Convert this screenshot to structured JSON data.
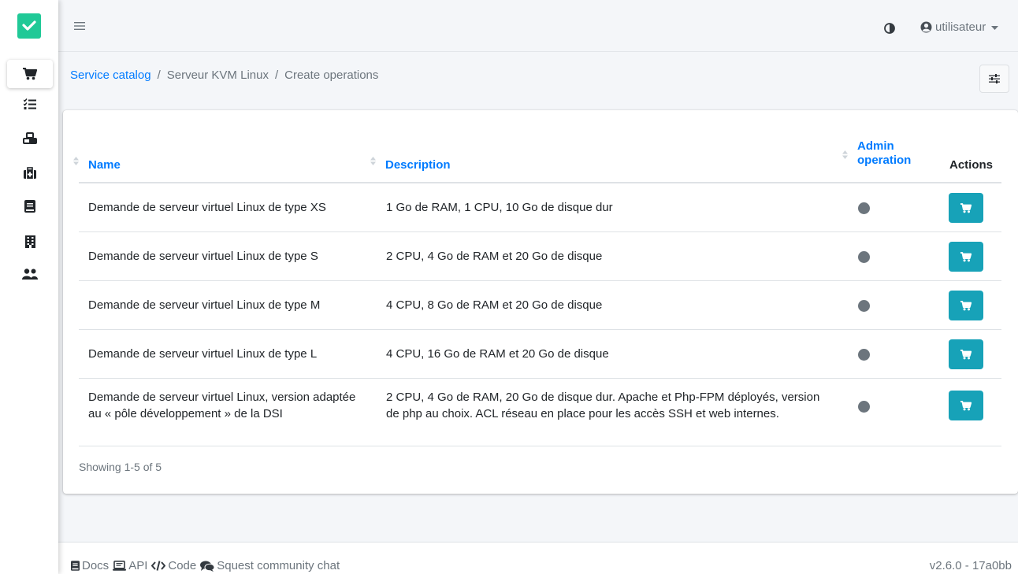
{
  "app": {
    "brand_color": "#20c997",
    "accent_color": "#17a2b8",
    "link_color": "#007bff"
  },
  "sidebar": {
    "items": [
      {
        "icon": "cart-icon",
        "active": true
      },
      {
        "icon": "tasks-icon",
        "active": false
      },
      {
        "icon": "cubes-icon",
        "active": false
      },
      {
        "icon": "medkit-icon",
        "active": false
      },
      {
        "icon": "book-icon",
        "active": false
      },
      {
        "icon": "building-icon",
        "active": false
      },
      {
        "icon": "users-icon",
        "active": false
      }
    ]
  },
  "header": {
    "user_name": "utilisateur"
  },
  "breadcrumb": {
    "items": [
      "Service catalog",
      "Serveur KVM Linux",
      "Create operations"
    ]
  },
  "table": {
    "columns": {
      "name": "Name",
      "description": "Description",
      "admin_line1": "Admin",
      "admin_line2": "operation",
      "actions": "Actions"
    },
    "rows": [
      {
        "name": "Demande de serveur virtuel Linux de type XS",
        "description": "1 Go de RAM, 1 CPU, 10 Go de disque dur"
      },
      {
        "name": "Demande de serveur virtuel Linux de type S",
        "description": "2 CPU, 4 Go de RAM et 20 Go de disque"
      },
      {
        "name": "Demande de serveur virtuel Linux de type M",
        "description": "4 CPU, 8 Go de RAM et 20 Go de disque"
      },
      {
        "name": "Demande de serveur virtuel Linux de type L",
        "description": "4 CPU, 16 Go de RAM et 20 Go de disque"
      },
      {
        "name_line1": "Demande de serveur virtuel Linux, version adaptée",
        "name_line2": "au « pôle développement » de la DSI",
        "description_line1": "2 CPU, 4 Go de RAM, 20 Go de disque dur. Apache et Php-FPM déployés, version",
        "description_line2": "de php au choix. ACL réseau en place pour les accès SSH et web internes."
      }
    ],
    "showing": "Showing 1-5 of 5"
  },
  "footer": {
    "links": [
      "Docs",
      "API",
      "Code",
      "Squest community chat"
    ],
    "version": "v2.6.0 - 17a0bb"
  }
}
